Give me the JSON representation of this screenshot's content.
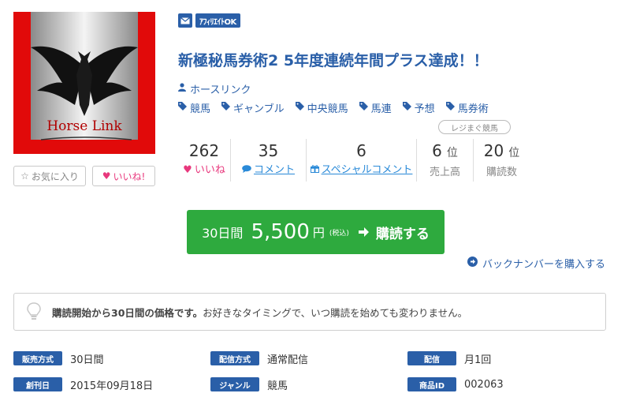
{
  "thumbnail": {
    "logo_text": "Horse Link"
  },
  "buttons": {
    "favorite_label": "お気に入り",
    "like_label": "いいね!"
  },
  "badges": {
    "affiliate_label": "ｱﾌｨﾘｴｲﾄOK"
  },
  "title": "新極秘馬券術2 5年度連続年間プラス達成！！",
  "author": "ホースリンク",
  "tags": [
    "競馬",
    "ギャンブル",
    "中央競馬",
    "馬連",
    "予想",
    "馬券術"
  ],
  "ranking_pill": "レジまぐ競馬",
  "stats": {
    "likes": {
      "value": "262",
      "label": "いいね"
    },
    "comments": {
      "value": "35",
      "label": "コメント"
    },
    "special_comments": {
      "value": "6",
      "label": "スペシャルコメント"
    },
    "sales_rank": {
      "value": "6",
      "unit": "位",
      "label": "売上高"
    },
    "subscriber_rank": {
      "value": "20",
      "unit": "位",
      "label": "購読数"
    }
  },
  "purchase": {
    "period": "30日間",
    "price": "5,500",
    "yen": "円",
    "tax": "(税込)",
    "cta": "購読する"
  },
  "backnumber_link": "バックナンバーを購入する",
  "info": {
    "bold_text": "購読開始から30日間の価格です。",
    "text": "お好きなタイミングで、いつ購読を始めても変わりません。"
  },
  "meta": [
    [
      {
        "label": "販売方式",
        "value": "30日間"
      },
      {
        "label": "配信方式",
        "value": "通常配信"
      },
      {
        "label": "配信",
        "value": "月1回"
      }
    ],
    [
      {
        "label": "創刊日",
        "value": "2015年09月18日"
      },
      {
        "label": "ジャンル",
        "value": "競馬"
      },
      {
        "label": "商品ID",
        "value": "002063"
      }
    ]
  ],
  "colors": {
    "primary_blue": "#2a5fa8",
    "link_blue": "#2a8ad8",
    "buy_green": "#2eaa3e",
    "like_pink": "#e8387d"
  }
}
